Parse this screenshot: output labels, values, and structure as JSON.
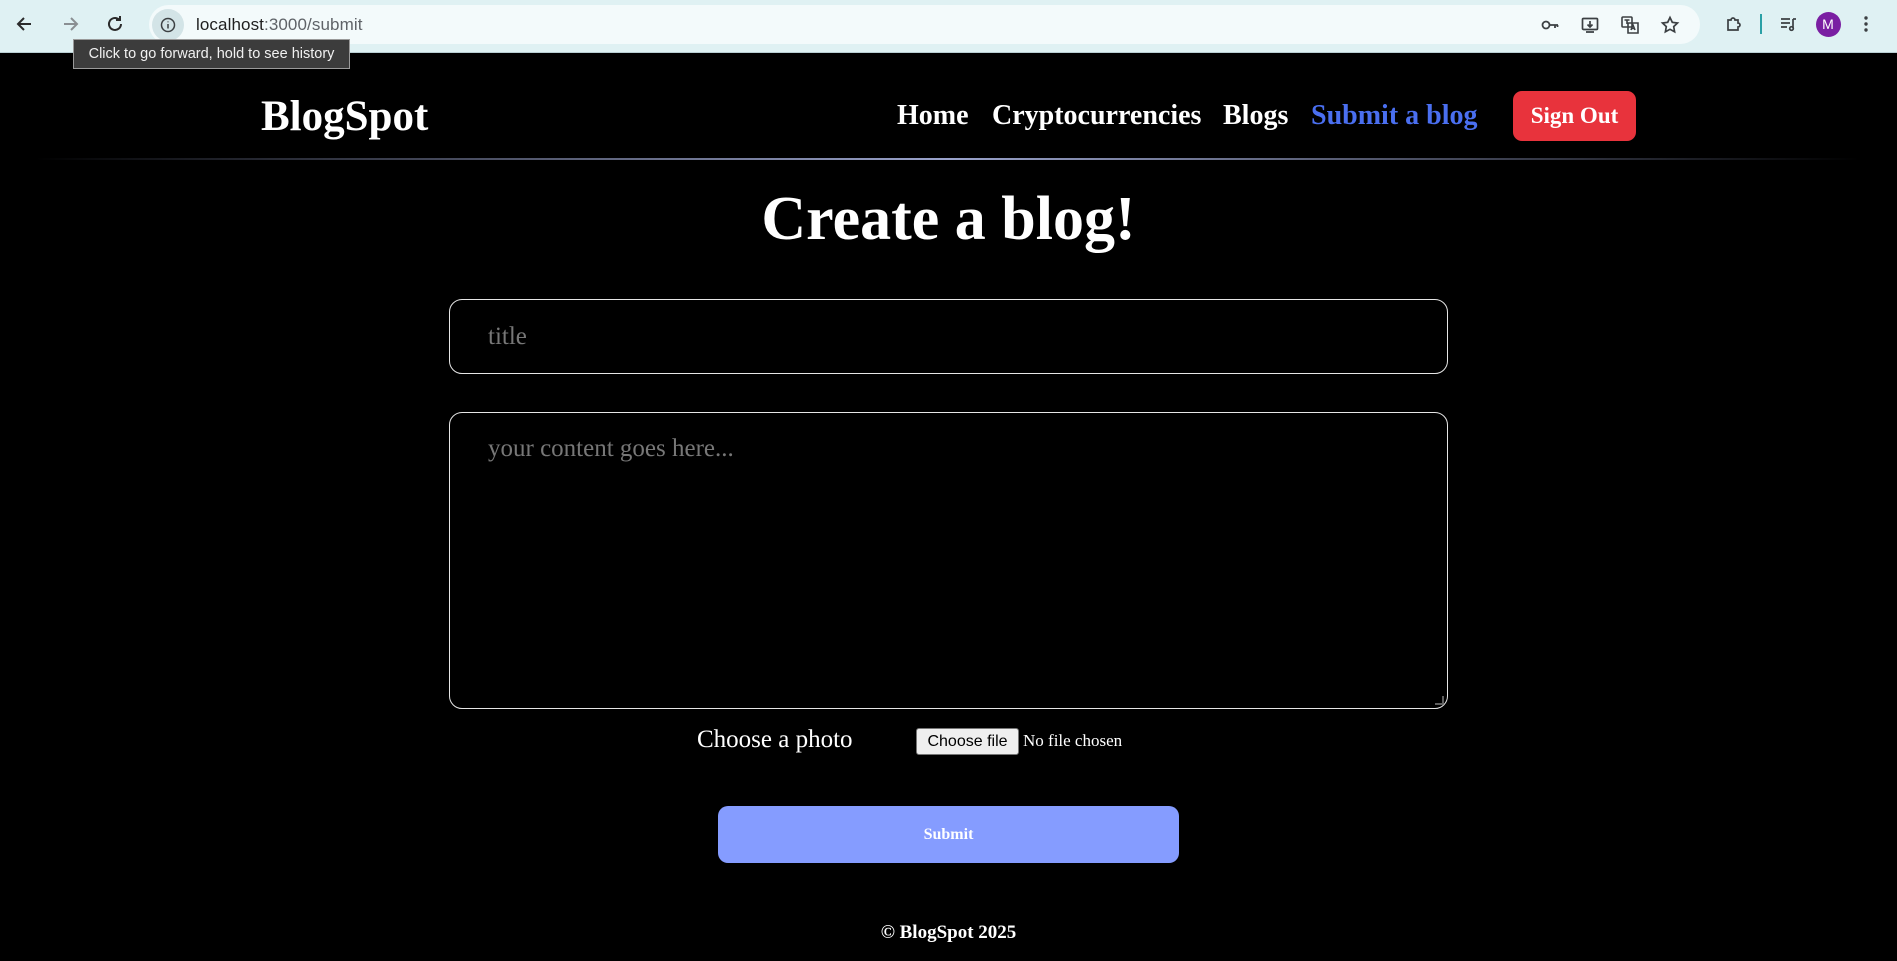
{
  "browser": {
    "url_host": "localhost",
    "url_path": ":3000/submit",
    "tooltip": "Click to go forward, hold to see history",
    "avatar_letter": "M",
    "accent_color": "#2aa0a6"
  },
  "header": {
    "logo": "BlogSpot",
    "nav": [
      "Home",
      "Cryptocurrencies",
      "Blogs",
      "Submit a blog"
    ],
    "active_nav": "Submit a blog",
    "signout_label": "Sign Out",
    "signout_color": "#e8333c",
    "active_color": "#4a6ff0"
  },
  "form": {
    "heading": "Create a blog!",
    "title_placeholder": "title",
    "content_placeholder": "your content goes here...",
    "photo_label": "Choose a photo",
    "file_button_label": "Choose file",
    "file_status": "No file chosen",
    "submit_label": "Submit",
    "submit_color": "#859cff"
  },
  "footer": {
    "text": "© BlogSpot 2025"
  }
}
